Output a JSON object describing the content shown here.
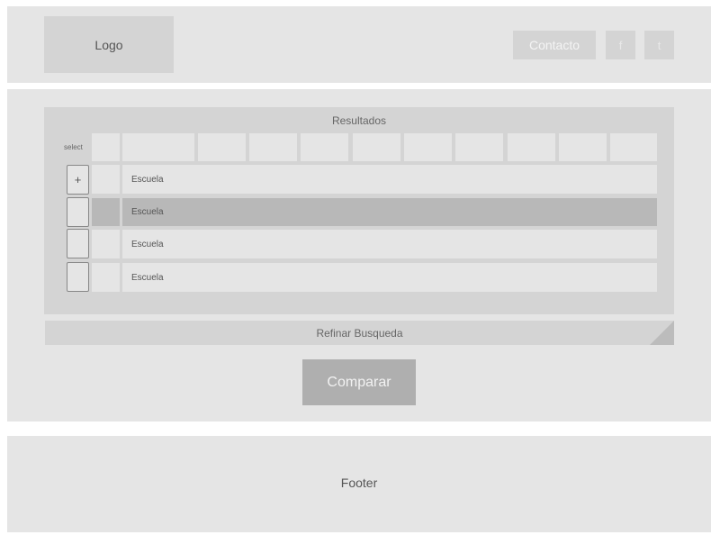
{
  "header": {
    "logo_label": "Logo",
    "contact_label": "Contacto",
    "social": {
      "facebook": "f",
      "twitter": "t"
    }
  },
  "results": {
    "title": "Resultados",
    "select_label": "select",
    "rows": [
      {
        "expand_symbol": "+",
        "label": "Escuela",
        "highlighted": false
      },
      {
        "expand_symbol": "",
        "label": "Escuela",
        "highlighted": true
      },
      {
        "expand_symbol": "",
        "label": "Escuela",
        "highlighted": false
      },
      {
        "expand_symbol": "",
        "label": "Escuela",
        "highlighted": false
      }
    ]
  },
  "refine": {
    "label": "Refinar Busqueda"
  },
  "compare": {
    "label": "Comparar"
  },
  "footer": {
    "label": "Footer"
  },
  "colors": {
    "band": "#e5e5e5",
    "panel": "#d4d4d4",
    "highlight_row": "#b8b8b8",
    "compare_button": "#afafaf"
  }
}
